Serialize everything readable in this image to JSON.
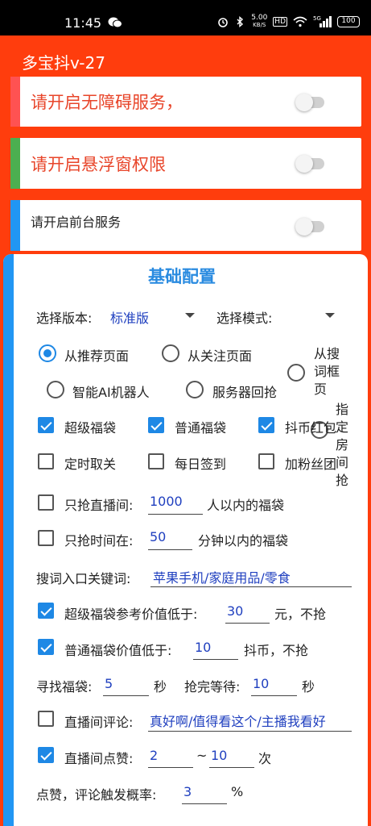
{
  "status": {
    "time": "11:45",
    "speed_value": "5.00",
    "speed_unit": "KB/S",
    "hd": "HD",
    "signal": "5G",
    "battery": "100"
  },
  "app": {
    "title": "多宝抖v-27"
  },
  "permissions": [
    {
      "label": "请开启无障碍服务，",
      "color": "#e8452a",
      "bar": "#ff5252"
    },
    {
      "label": "请开启悬浮窗权限",
      "color": "#e8452a",
      "bar": "#4caf50"
    },
    {
      "label": "请开启前台服务",
      "color": "#222222",
      "bar": "#2196f3"
    }
  ],
  "config": {
    "title": "基础配置",
    "version_label": "选择版本:",
    "version_value": "标准版",
    "mode_label": "选择模式:",
    "mode_value": "",
    "radios": {
      "recommend": "从推荐页面",
      "follow": "从关注页面",
      "search": "从搜词框页",
      "ai": "智能AI机器人",
      "server": "服务器回抢",
      "room": "指定房间抢"
    },
    "checks": {
      "super_bag": "超级福袋",
      "normal_bag": "普通福袋",
      "coin_red": "抖币红包",
      "timed_off": "定时取关",
      "daily_sign": "每日签到",
      "fan_group": "加粉丝团"
    },
    "live_only_label": "只抢直播间:",
    "live_only_value": "1000",
    "live_only_suffix": "人以内的福袋",
    "time_only_label": "只抢时间在:",
    "time_only_value": "50",
    "time_only_suffix": "分钟以内的福袋",
    "keywords_label": "搜词入口关键词:",
    "keywords_value": "苹果手机/家庭用品/零食",
    "super_min_label": "超级福袋参考价值低于:",
    "super_min_value": "30",
    "super_min_suffix": "元，不抢",
    "normal_min_label": "普通福袋价值低于:",
    "normal_min_value": "10",
    "normal_min_suffix": "抖币，不抢",
    "find_label": "寻找福袋:",
    "find_value": "5",
    "find_unit": "秒",
    "wait_label": "抢完等待:",
    "wait_value": "10",
    "wait_unit": "秒",
    "comment_label": "直播间评论:",
    "comment_value": "真好啊/值得看这个/主播我看好",
    "like_label": "直播间点赞:",
    "like_min": "2",
    "like_tilde": "~",
    "like_max": "10",
    "like_unit": "次",
    "prob_label": "点赞，评论触发概率:",
    "prob_value": "3",
    "prob_unit": "%"
  }
}
